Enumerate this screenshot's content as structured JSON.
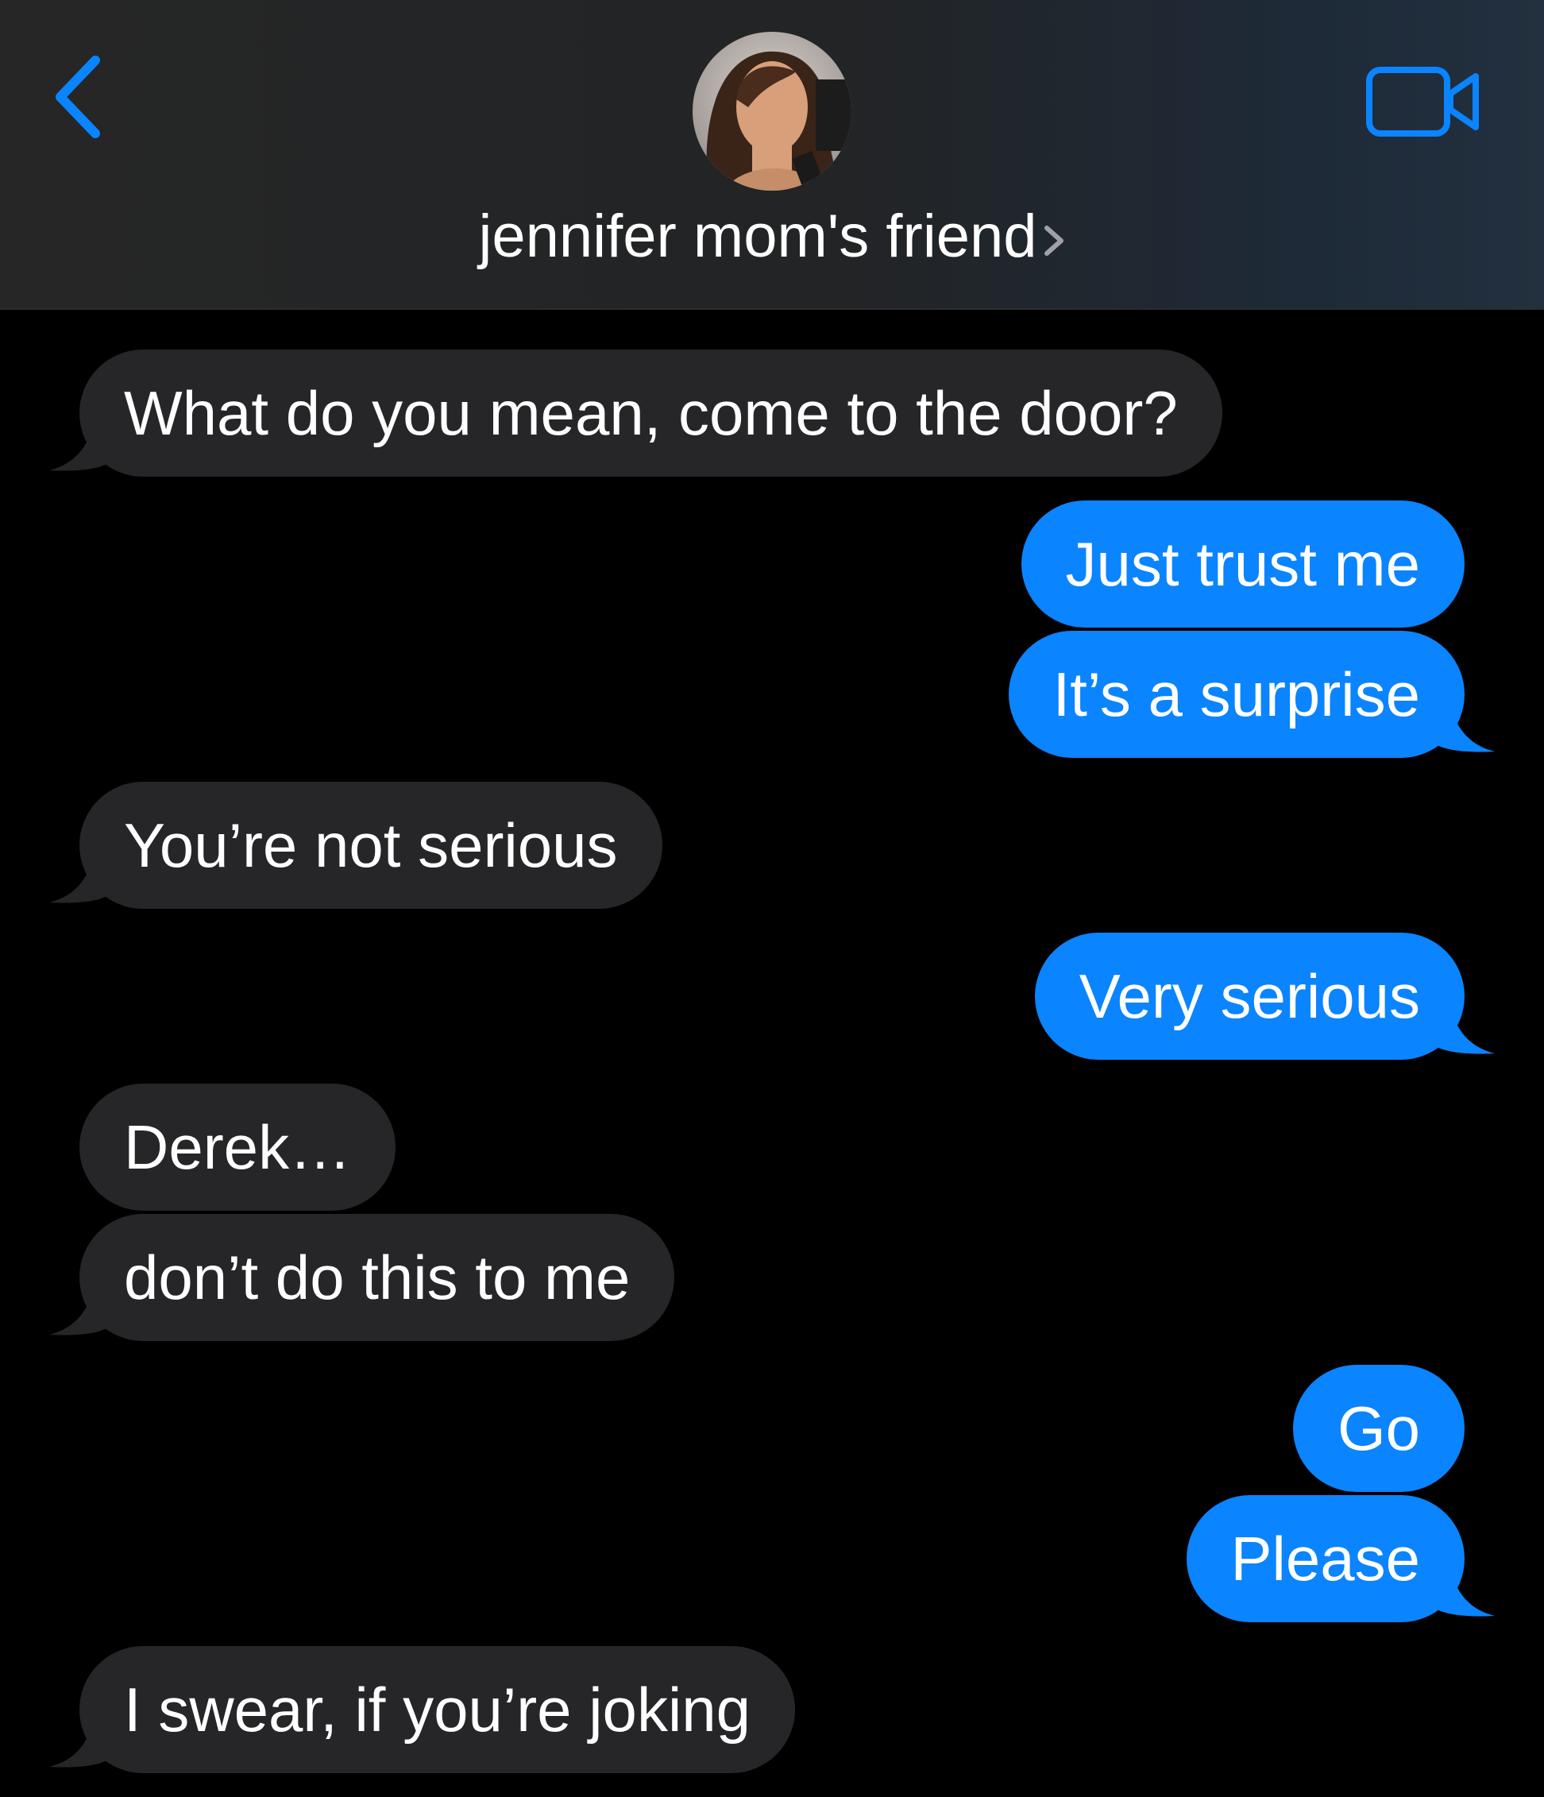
{
  "header": {
    "contact_name": "jennifer mom's friend",
    "icons": {
      "back": "chevron-left-icon",
      "disclosure": "chevron-right-icon",
      "video": "video-camera-icon"
    },
    "accent_color": "#0a84ff"
  },
  "messages": [
    {
      "direction": "incoming",
      "text": "What do you mean, come to the door?",
      "tail": true
    },
    {
      "direction": "outgoing",
      "text": "Just trust me",
      "tail": false
    },
    {
      "direction": "outgoing",
      "text": "It’s a surprise",
      "tail": true
    },
    {
      "direction": "incoming",
      "text": "You’re not serious",
      "tail": true
    },
    {
      "direction": "outgoing",
      "text": "Very serious",
      "tail": true
    },
    {
      "direction": "incoming",
      "text": "Derek…",
      "tail": false
    },
    {
      "direction": "incoming",
      "text": "don’t do this to me",
      "tail": true
    },
    {
      "direction": "outgoing",
      "text": "Go",
      "tail": false
    },
    {
      "direction": "outgoing",
      "text": "Please",
      "tail": true
    },
    {
      "direction": "incoming",
      "text": "I swear, if you’re joking",
      "tail": true
    }
  ],
  "colors": {
    "incoming_bubble": "#262629",
    "outgoing_bubble": "#0a84ff",
    "background": "#000000"
  }
}
